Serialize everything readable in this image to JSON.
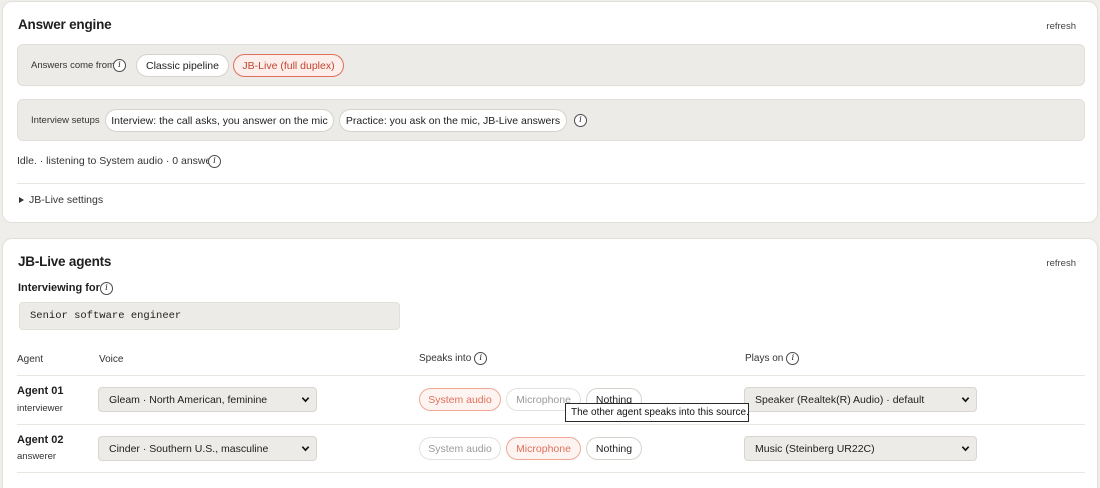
{
  "answer_engine": {
    "title": "Answer engine",
    "refresh": "refresh",
    "source_label": "Answers come from",
    "source_options": [
      "Classic pipeline",
      "JB-Live (full duplex)"
    ],
    "selected_source": "JB-Live (full duplex)",
    "setups_label": "Interview setups",
    "setups": [
      "Interview: the call asks, you answer on the mic",
      "Practice: you ask on the mic, JB-Live answers"
    ],
    "status": "Idle. · listening to System audio · 0 answers",
    "settings_label": "JB-Live settings"
  },
  "agents": {
    "title": "JB-Live agents",
    "refresh": "refresh",
    "interviewing_label": "Interviewing for",
    "interviewing_value": "Senior software engineer",
    "columns": {
      "agent": "Agent",
      "voice": "Voice",
      "speaks_into": "Speaks into",
      "plays_on": "Plays on"
    },
    "route_options": [
      "System audio",
      "Microphone",
      "Nothing"
    ],
    "rows": [
      {
        "name": "Agent 01",
        "role": "interviewer",
        "voice": "Gleam · North American, feminine",
        "speaks_into": "System audio",
        "plays_on": "Speaker (Realtek(R) Audio) · default"
      },
      {
        "name": "Agent 02",
        "role": "answerer",
        "voice": "Cinder · Southern U.S., masculine",
        "speaks_into": "Microphone",
        "plays_on": "Music (Steinberg UR22C)"
      }
    ],
    "tooltip": "The other agent speaks into this source."
  },
  "icons": {
    "info": "i"
  },
  "colors": {
    "accent": "#c4452e",
    "accent_light": "#e0705c",
    "panel": "#ecebe7",
    "page_bg": "#f0eeea"
  }
}
